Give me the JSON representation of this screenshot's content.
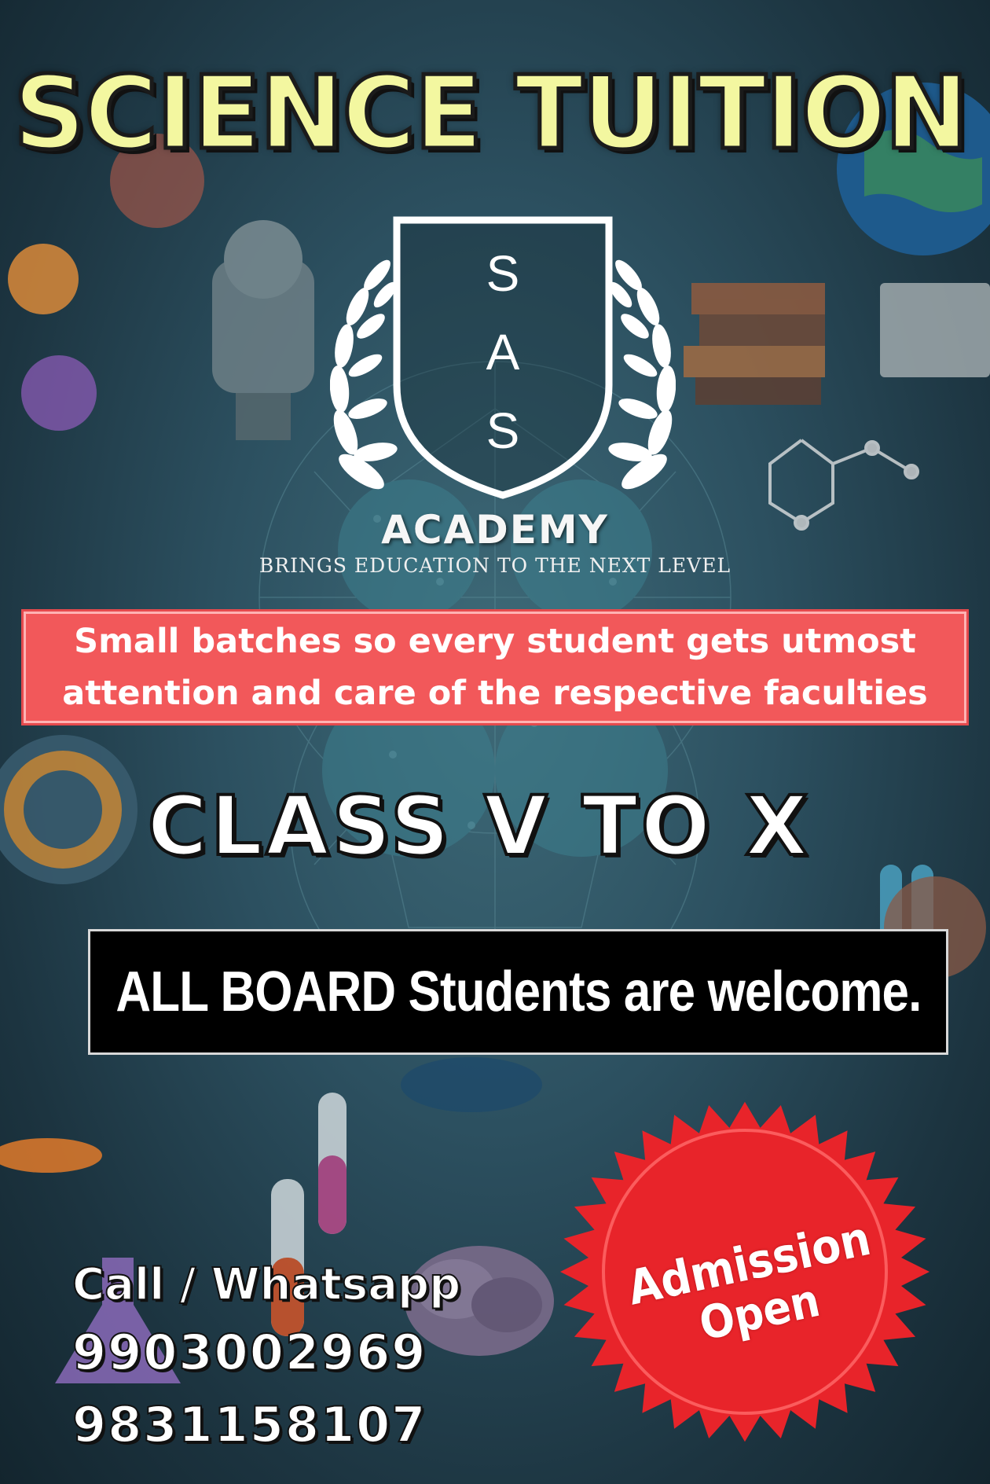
{
  "poster": {
    "title": "SCIENCE TUITION",
    "logo": {
      "letters": [
        "S",
        "A",
        "S"
      ],
      "name": "ACADEMY",
      "tagline": "BRINGS EDUCATION TO THE NEXT LEVEL"
    },
    "note": "Small batches so every student gets utmost attention and care of the respective faculties",
    "class_range": "CLASS V TO X",
    "board_notice": "ALL BOARD Students are welcome.",
    "contact": {
      "label": "Call / Whatsapp",
      "phones": [
        "9903002969",
        "9831158107"
      ]
    },
    "badge": {
      "line1": "Admission",
      "line2": "Open"
    }
  },
  "colors": {
    "title_fill": "#f3f7a0",
    "note_background": "#f2585a",
    "badge_red": "#e8242a",
    "background": "#2c5060"
  },
  "icons": [
    "laurel-wreath-icon",
    "shield-icon",
    "test-tube-icon",
    "brain-icon",
    "molecule-icon",
    "book-stack-icon",
    "globe-icon",
    "microscope-icon"
  ]
}
